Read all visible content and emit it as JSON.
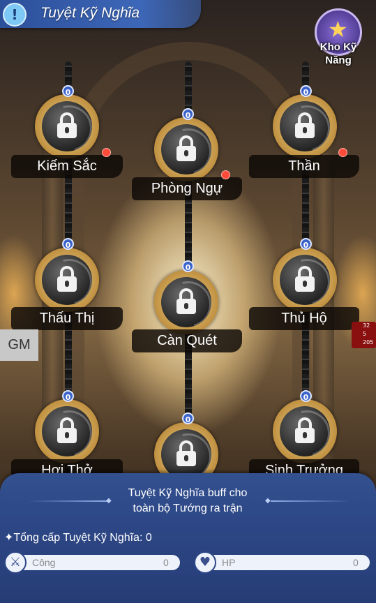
{
  "header": {
    "title": "Tuyệt Kỹ Nghĩa",
    "icon": "exclamation-icon",
    "icon_glyph": "!"
  },
  "skill_book": {
    "label": "Kho Kỹ Năng",
    "icon": "skill-book-icon",
    "glyph": "★"
  },
  "nodes": [
    {
      "name": "Kiếm Sắc",
      "level": "0",
      "locked": true,
      "notify": true
    },
    {
      "name": "Phòng Ngự",
      "level": "0",
      "locked": true,
      "notify": true
    },
    {
      "name": "Thần",
      "level": "0",
      "locked": true,
      "notify": true
    },
    {
      "name": "Thấu Thị",
      "level": "0",
      "locked": true,
      "notify": false
    },
    {
      "name": "Càn Quét",
      "level": "0",
      "locked": true,
      "notify": false
    },
    {
      "name": "Thủ Hộ",
      "level": "0",
      "locked": true,
      "notify": false
    },
    {
      "name": "Hơi Thở",
      "level": "0",
      "locked": true,
      "notify": false
    },
    {
      "name": "",
      "level": "0",
      "locked": true,
      "notify": false
    },
    {
      "name": "Sinh Trưởng",
      "level": "0",
      "locked": true,
      "notify": false
    }
  ],
  "gm_button": {
    "label": "GM"
  },
  "alerts": {
    "a": "32",
    "b": "5",
    "c": "205"
  },
  "panel": {
    "description_line1": "Tuyệt Kỹ Nghĩa buff cho",
    "description_line2": "toàn bộ Tướng ra trận",
    "total_label": "✦Tổng cấp Tuyệt Kỹ Nghĩa: 0",
    "stats": [
      {
        "name": "Công",
        "value": "0",
        "icon": "sword-icon",
        "glyph": "⚔"
      },
      {
        "name": "HP",
        "value": "0",
        "icon": "heart-icon",
        "glyph": "♥"
      }
    ]
  },
  "colors": {
    "panel": "#2d4786",
    "badge": "#3a62c8",
    "notify": "#ff4b3a",
    "frame": "#c09040"
  }
}
